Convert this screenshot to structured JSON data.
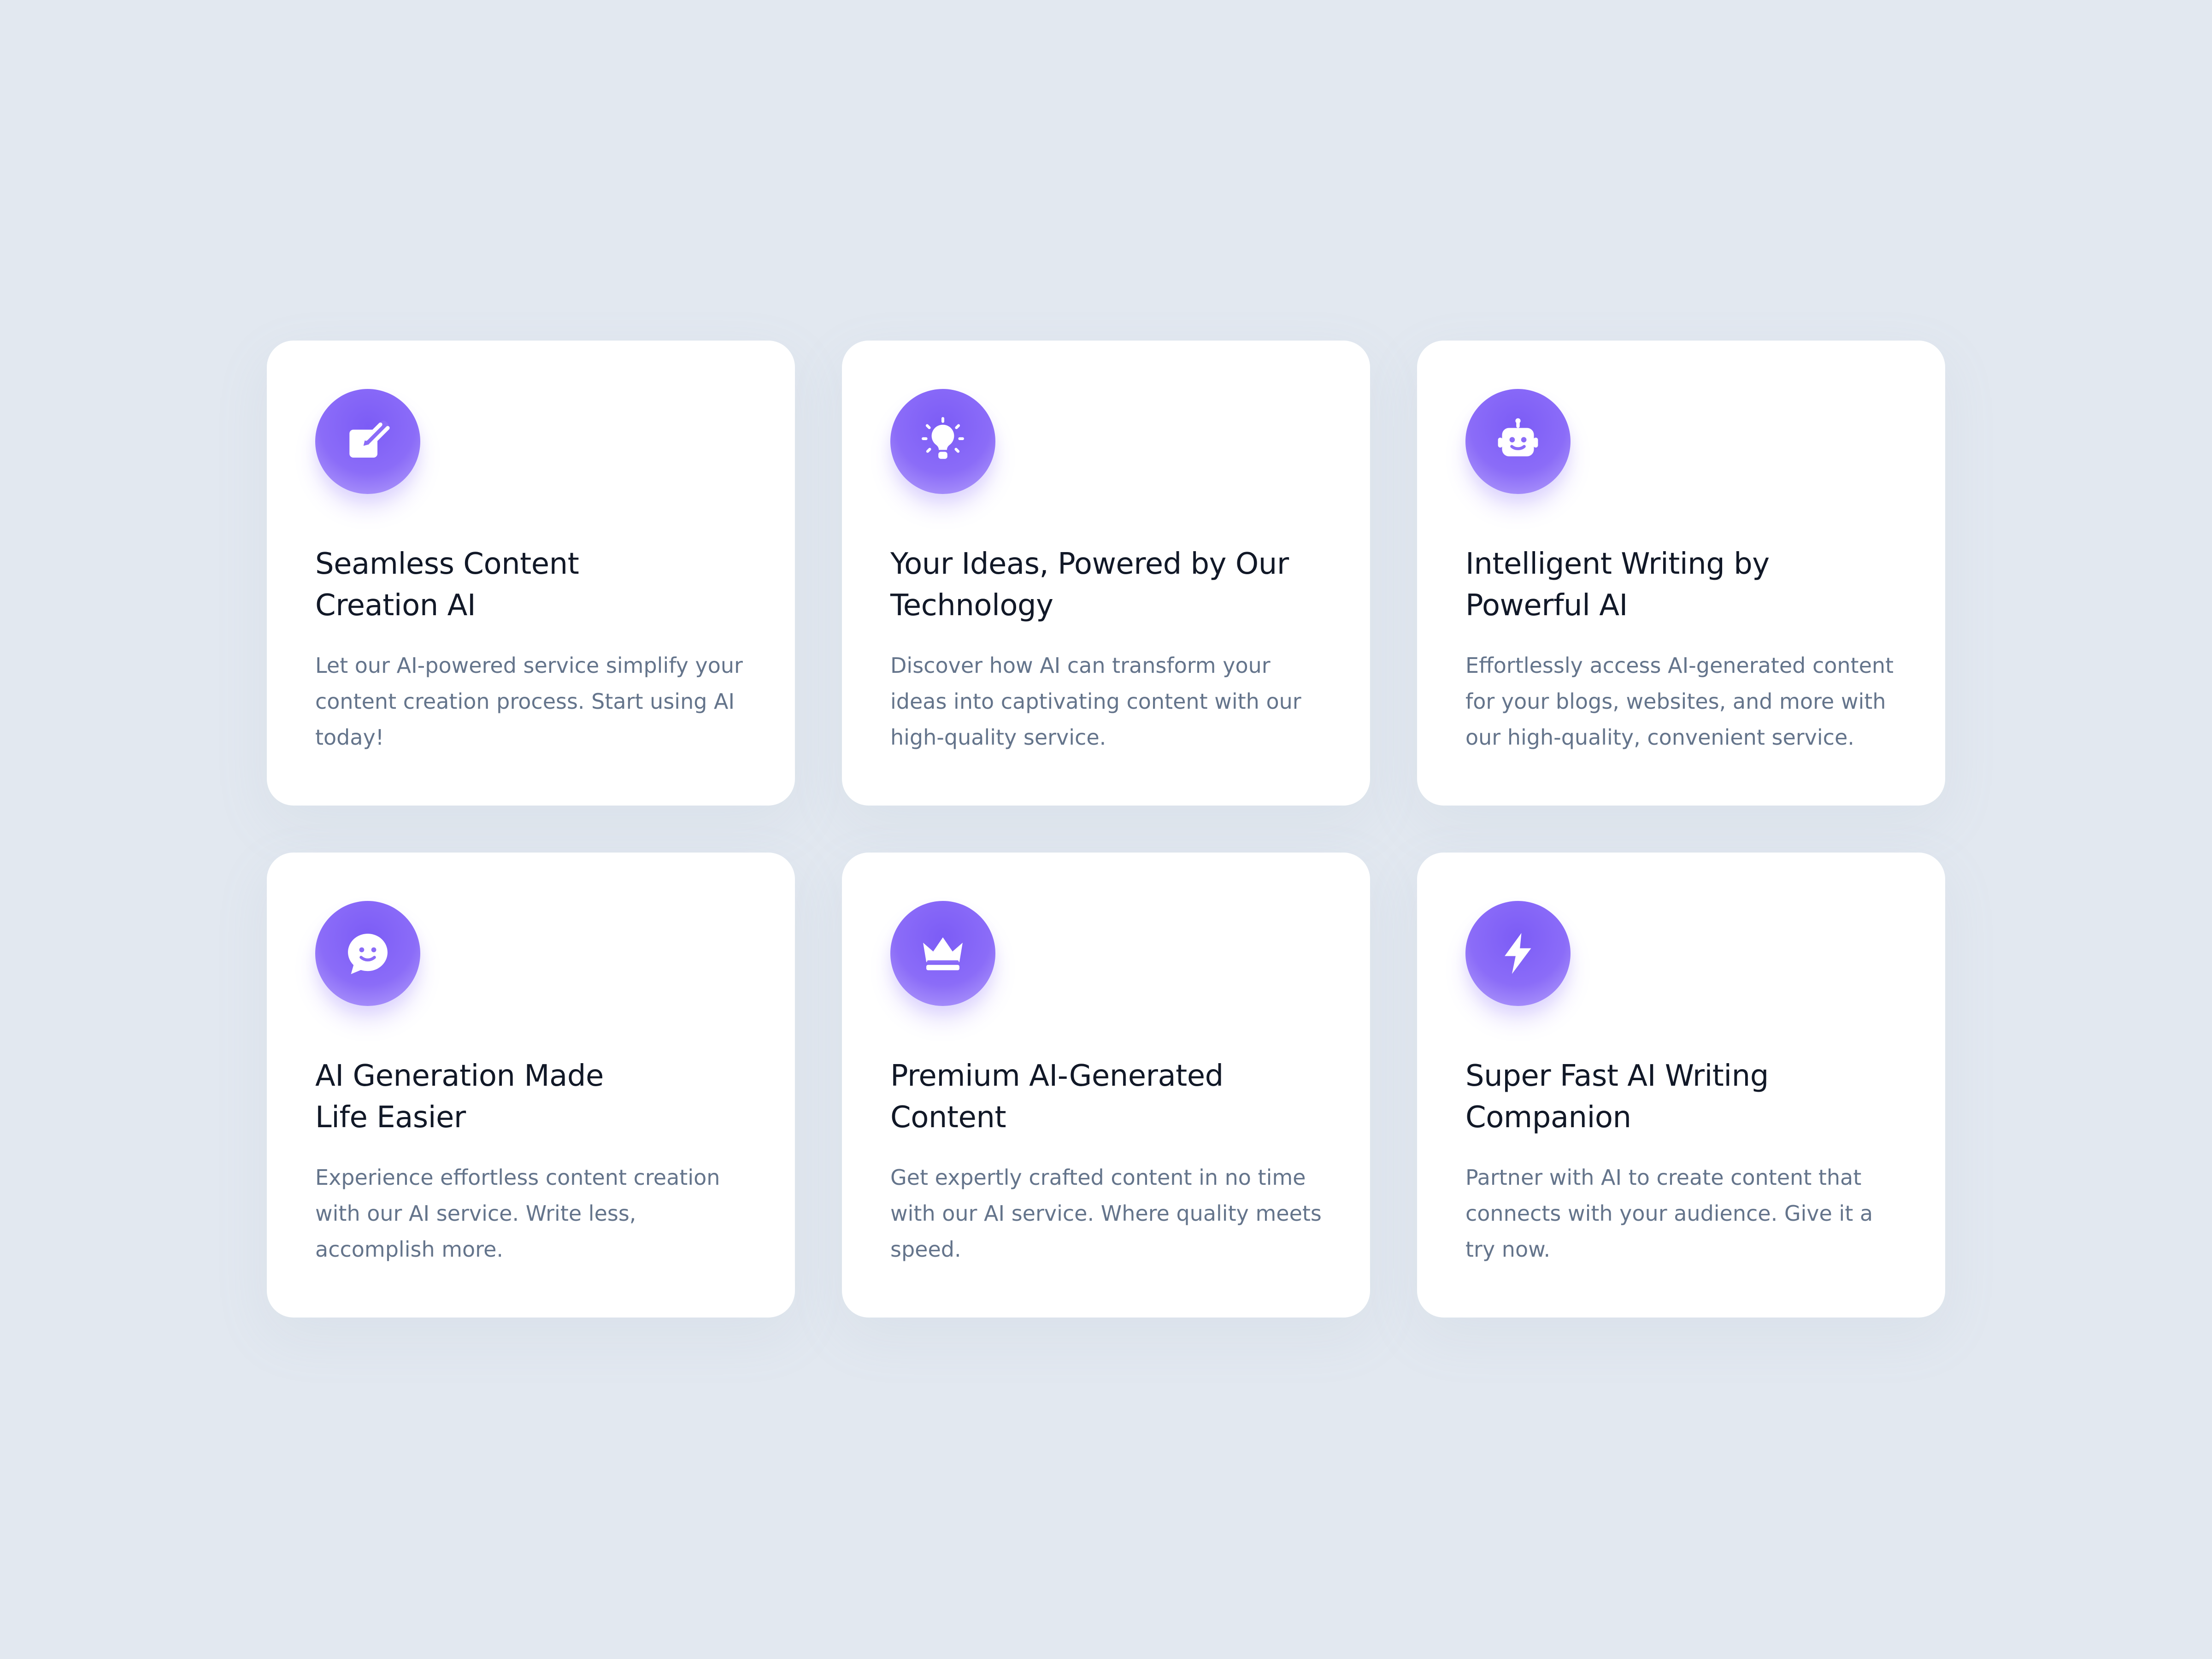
{
  "page": {
    "background_color": "#e2e8f0",
    "accent_color": "#8b6cf8"
  },
  "cards": [
    {
      "icon": "edit-icon",
      "title": "Seamless Content\nCreation AI",
      "description": "Let our AI-powered service simplify your content creation process. Start using AI today!"
    },
    {
      "icon": "lightbulb-icon",
      "title": "Your Ideas, Powered by Our\nTechnology",
      "description": "Discover how AI can transform your ideas into captivating content with our high-quality service."
    },
    {
      "icon": "robot-icon",
      "title": "Intelligent Writing by\nPowerful AI",
      "description": "Effortlessly access AI-generated content for your blogs, websites, and more with our high-quality, convenient service."
    },
    {
      "icon": "smiley-chat-icon",
      "title": "AI Generation Made\nLife Easier",
      "description": "Experience effortless content creation with our AI service. Write less, accomplish more."
    },
    {
      "icon": "crown-icon",
      "title": "Premium AI-Generated\nContent",
      "description": "Get expertly crafted content in no time with our AI service. Where quality meets speed."
    },
    {
      "icon": "lightning-icon",
      "title": "Super Fast AI Writing\nCompanion",
      "description": "Partner with AI to create content that connects with your audience. Give it a try now."
    }
  ]
}
